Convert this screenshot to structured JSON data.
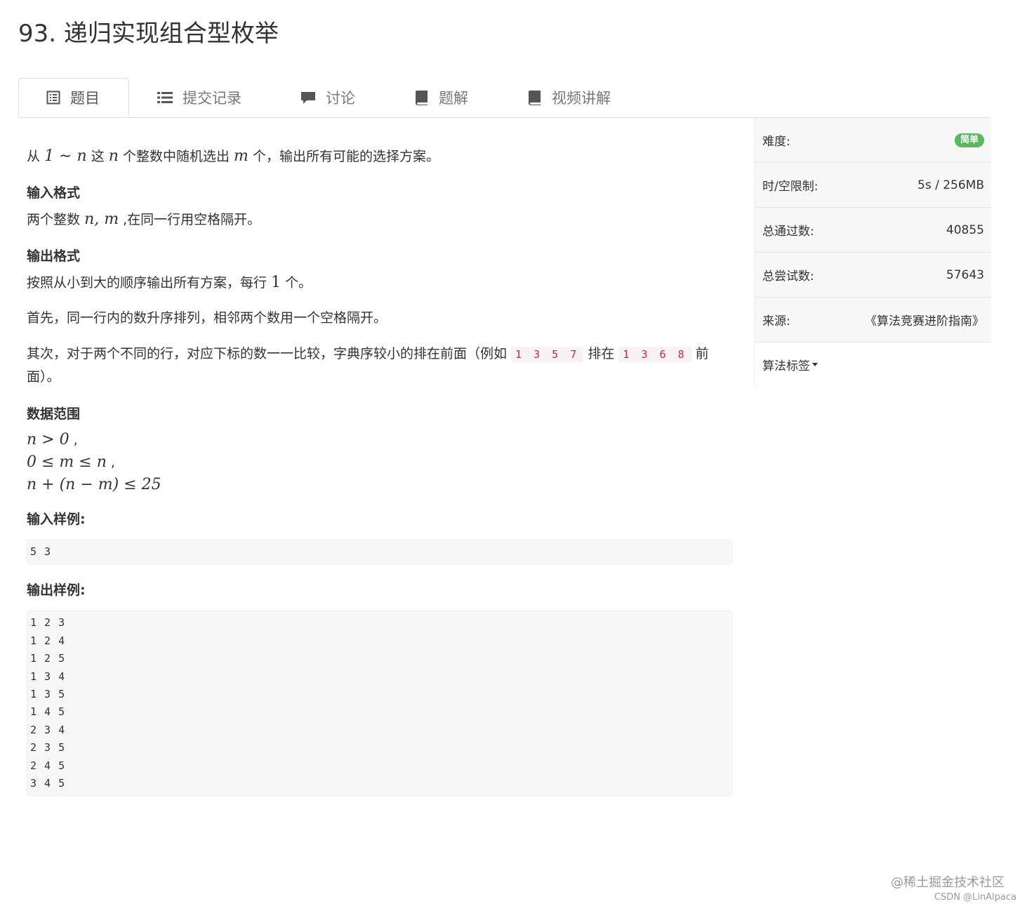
{
  "title": "93. 递归实现组合型枚举",
  "tabs": [
    {
      "label": "题目",
      "icon": "list-alt-icon"
    },
    {
      "label": "提交记录",
      "icon": "list-icon"
    },
    {
      "label": "讨论",
      "icon": "comment-icon"
    },
    {
      "label": "题解",
      "icon": "book-icon"
    },
    {
      "label": "视频讲解",
      "icon": "book-icon"
    }
  ],
  "problem": {
    "intro": {
      "p1": "从",
      "m1": "1 ∼ n",
      "p2": "这",
      "m2": "n",
      "p3": "个整数中随机选出",
      "m3": "m",
      "p4": "个，输出所有可能的选择方案。"
    },
    "input_heading": "输入格式",
    "input_text": {
      "p1": "两个整数",
      "m1": "n, m",
      "p2": ",在同一行用空格隔开。"
    },
    "output_heading": "输出格式",
    "output_text": {
      "p1": "按照从小到大的顺序输出所有方案，每行",
      "m1": "1",
      "p2": "个。"
    },
    "first": "首先，同一行内的数升序排列，相邻两个数用一个空格隔开。",
    "second": {
      "p1": "其次，对于两个不同的行，对应下标的数一一比较，字典序较小的排在前面（例如",
      "c1": "1 3 5 7",
      "p2": "排在",
      "c2": "1 3 6 8",
      "p3": "前面）。"
    },
    "range_heading": "数据范围",
    "ranges": [
      {
        "math": "n > 0",
        "suffix": " ,"
      },
      {
        "math": "0 ≤ m ≤ n",
        "suffix": " ,"
      },
      {
        "math": "n + (n − m) ≤ 25",
        "suffix": ""
      }
    ],
    "sample_input_heading": "输入样例:",
    "sample_input": "5 3",
    "sample_output_heading": "输出样例:",
    "sample_output": "1 2 3\n1 2 4\n1 2 5\n1 3 4\n1 3 5\n1 4 5\n2 3 4\n2 3 5\n2 4 5\n3 4 5"
  },
  "sidebar": {
    "difficulty_label": "难度:",
    "difficulty_value": "简单",
    "limit_label": "时/空限制:",
    "limit_value": "5s / 256MB",
    "passed_label": "总通过数:",
    "passed_value": "40855",
    "attempts_label": "总尝试数:",
    "attempts_value": "57643",
    "source_label": "来源:",
    "source_value": "《算法竞赛进阶指南》",
    "tags_label": "算法标签"
  },
  "colors": {
    "badge": "#5cb85c",
    "code": "#c7254e"
  },
  "watermark": "@稀土掘金技术社区",
  "watermark_small": "CSDN @LinAlpaca"
}
